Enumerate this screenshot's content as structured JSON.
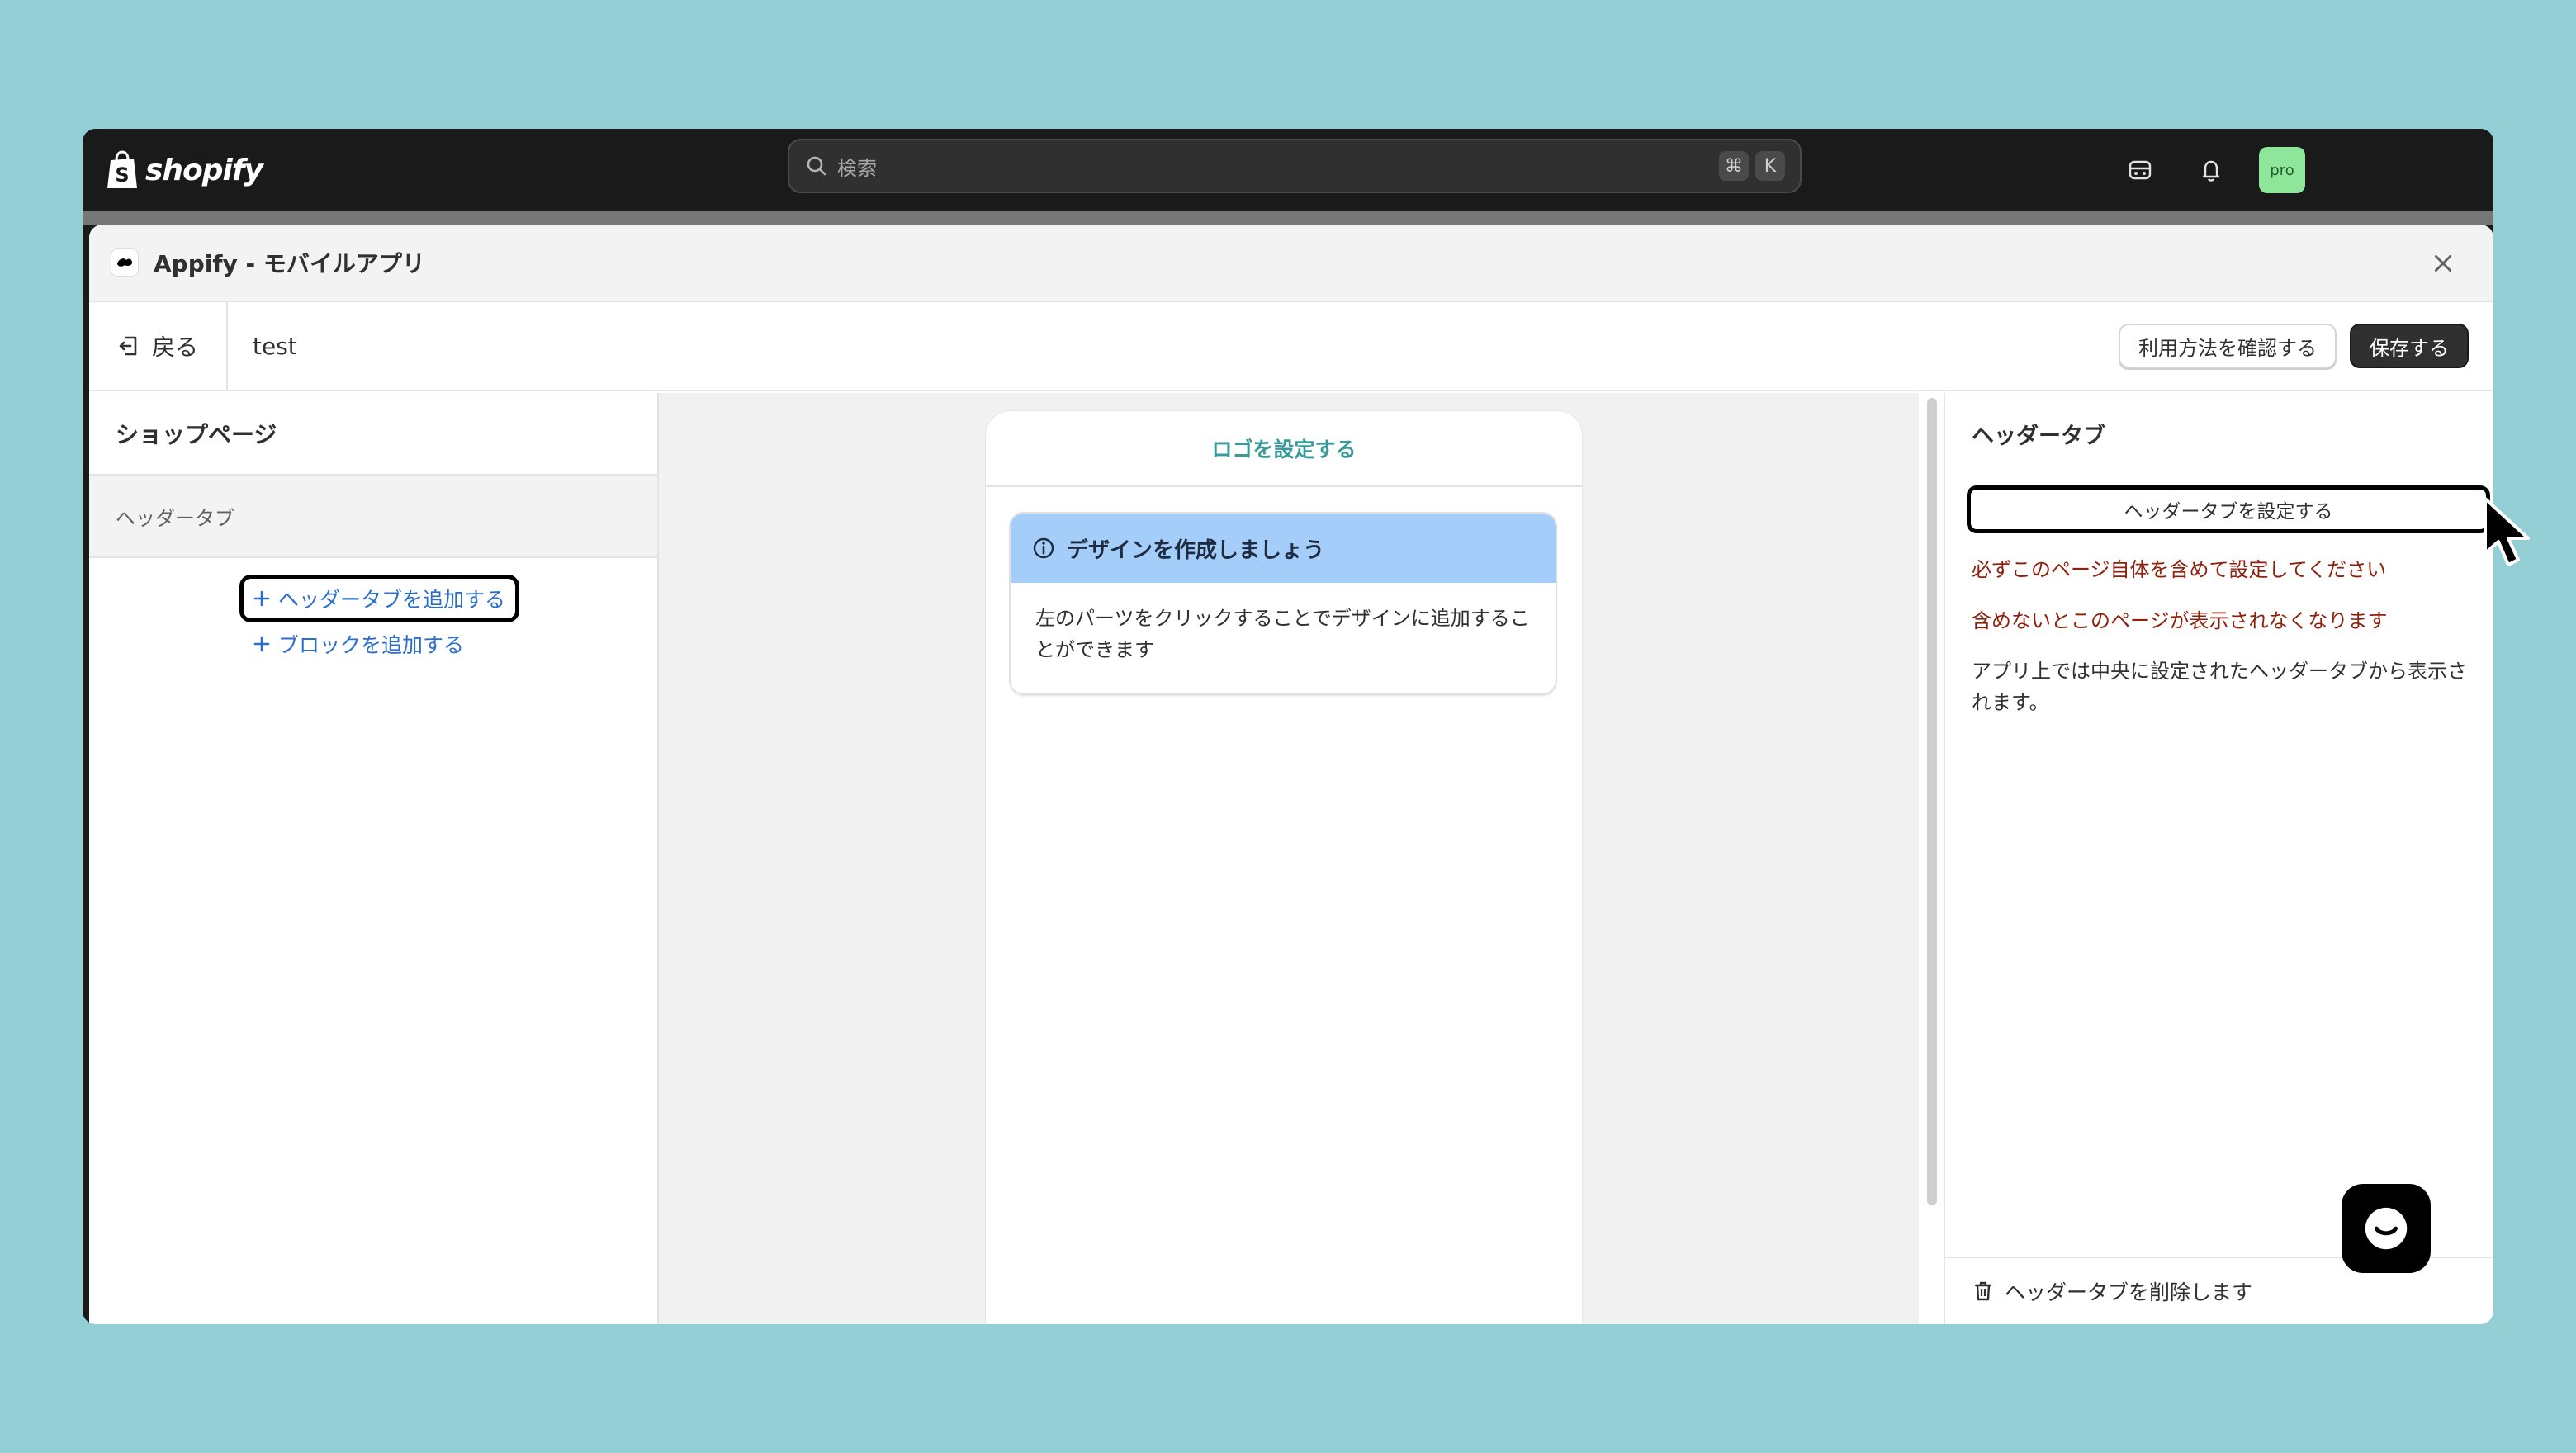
{
  "topbar": {
    "brand": "shopify",
    "search_placeholder": "検索",
    "shortcut_keys": [
      "⌘",
      "K"
    ],
    "avatar_label": "pro",
    "icons": [
      "store-icon",
      "bell-icon"
    ]
  },
  "modal": {
    "title": "Appify - モバイルアプリ"
  },
  "toolbar": {
    "back_label": "戻る",
    "page_name": "test",
    "help_label": "利用方法を確認する",
    "save_label": "保存する"
  },
  "left_panel": {
    "title": "ショップページ",
    "section": "ヘッダータブ",
    "add_header_tab": "ヘッダータブを追加する",
    "add_block": "ブロックを追加する"
  },
  "preview": {
    "logo_link": "ロゴを設定する",
    "banner_title": "デザインを作成しましょう",
    "banner_body": "左のパーツをクリックすることでデザインに追加することができます"
  },
  "right_panel": {
    "title": "ヘッダータブ",
    "set_button": "ヘッダータブを設定する",
    "warning_1": "必ずこのページ自体を含めて設定してください",
    "warning_2": "含めないとこのページが表示されなくなります",
    "note": "アプリ上では中央に設定されたヘッダータブから表示されます。",
    "delete_label": "ヘッダータブを削除します"
  },
  "colors": {
    "background": "#94cfd6",
    "topbar": "#1a1a1a",
    "link": "#2c6ecb",
    "banner": "#a4cdfa",
    "warning": "#8e1f0b",
    "avatar": "#8ee69b"
  }
}
